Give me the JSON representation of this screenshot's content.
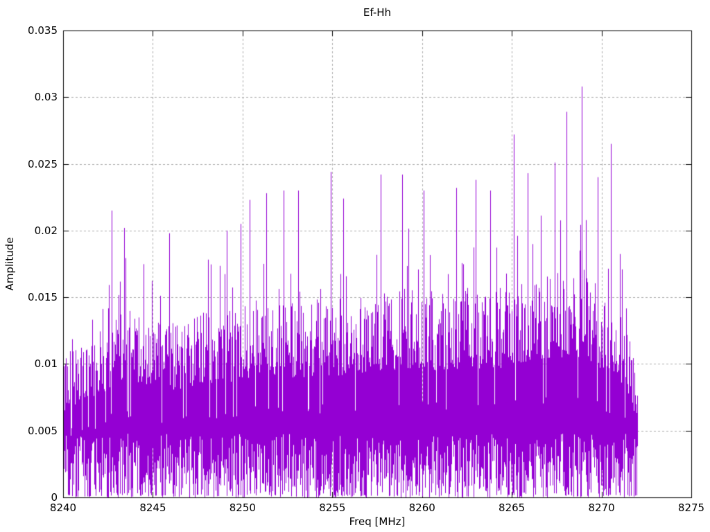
{
  "chart_data": {
    "type": "line",
    "title": "Ef-Hh",
    "xlabel": "Freq [MHz]",
    "ylabel": "Amplitude",
    "xlim": [
      8240,
      8275
    ],
    "ylim": [
      0,
      0.035
    ],
    "xticks": [
      8240,
      8245,
      8250,
      8255,
      8260,
      8265,
      8270,
      8275
    ],
    "yticks": [
      0,
      0.005,
      0.01,
      0.015,
      0.02,
      0.025,
      0.03,
      0.035
    ],
    "ytick_labels": [
      "0",
      "0.005",
      "0.01",
      "0.015",
      "0.02",
      "0.025",
      "0.03",
      "0.035"
    ],
    "grid": true,
    "legend": "none",
    "line_color": "#9400d3",
    "grid_color": "#ababab",
    "frame_color": "#000000",
    "text_color": "#000000",
    "background": "#ffffff",
    "signal": {
      "description": "Dense noise-like amplitude spectrum occupying 8240-8272 MHz, drawn as vertical min-max columns; bulk mass ~0.002-0.013 with spikes to ~0.02 and listed peaks above 0.02",
      "freq_start": 8240.0,
      "freq_end": 8272.0,
      "points": 900,
      "seed": 12345,
      "noise_floor_max": 0.0048,
      "envelope": [
        [
          8240,
          0.011
        ],
        [
          8241,
          0.0122
        ],
        [
          8242,
          0.013
        ],
        [
          8243,
          0.0147
        ],
        [
          8244,
          0.0147
        ],
        [
          8245,
          0.014
        ],
        [
          8246,
          0.0136
        ],
        [
          8247,
          0.014
        ],
        [
          8248,
          0.0146
        ],
        [
          8249,
          0.0147
        ],
        [
          8250,
          0.015
        ],
        [
          8251,
          0.0156
        ],
        [
          8252,
          0.0156
        ],
        [
          8253,
          0.0151
        ],
        [
          8254,
          0.0156
        ],
        [
          8255,
          0.0156
        ],
        [
          8256,
          0.0155
        ],
        [
          8257,
          0.016
        ],
        [
          8258,
          0.0161
        ],
        [
          8259,
          0.0166
        ],
        [
          8260,
          0.0165
        ],
        [
          8261,
          0.016
        ],
        [
          8262,
          0.0165
        ],
        [
          8263,
          0.0166
        ],
        [
          8264,
          0.0161
        ],
        [
          8265,
          0.017
        ],
        [
          8266,
          0.0175
        ],
        [
          8267,
          0.0176
        ],
        [
          8268,
          0.018
        ],
        [
          8269,
          0.018
        ],
        [
          8270,
          0.0162
        ],
        [
          8271,
          0.015
        ],
        [
          8271.6,
          0.0128
        ],
        [
          8272,
          0.009
        ]
      ],
      "peaks": [
        [
          8242.7,
          0.0215
        ],
        [
          8243.4,
          0.0202
        ],
        [
          8245.9,
          0.0198
        ],
        [
          8249.1,
          0.02
        ],
        [
          8249.9,
          0.0205
        ],
        [
          8250.4,
          0.0223
        ],
        [
          8251.3,
          0.0228
        ],
        [
          8252.3,
          0.023
        ],
        [
          8253.1,
          0.023
        ],
        [
          8254.9,
          0.0244
        ],
        [
          8255.6,
          0.0224
        ],
        [
          8257.7,
          0.0242
        ],
        [
          8258.9,
          0.0242
        ],
        [
          8260.1,
          0.023
        ],
        [
          8261.9,
          0.0232
        ],
        [
          8263.0,
          0.0238
        ],
        [
          8263.8,
          0.023
        ],
        [
          8265.1,
          0.0272
        ],
        [
          8265.9,
          0.0243
        ],
        [
          8267.4,
          0.0251
        ],
        [
          8268.05,
          0.0289
        ],
        [
          8268.9,
          0.0308
        ],
        [
          8269.8,
          0.024
        ],
        [
          8270.5,
          0.0265
        ]
      ]
    }
  }
}
